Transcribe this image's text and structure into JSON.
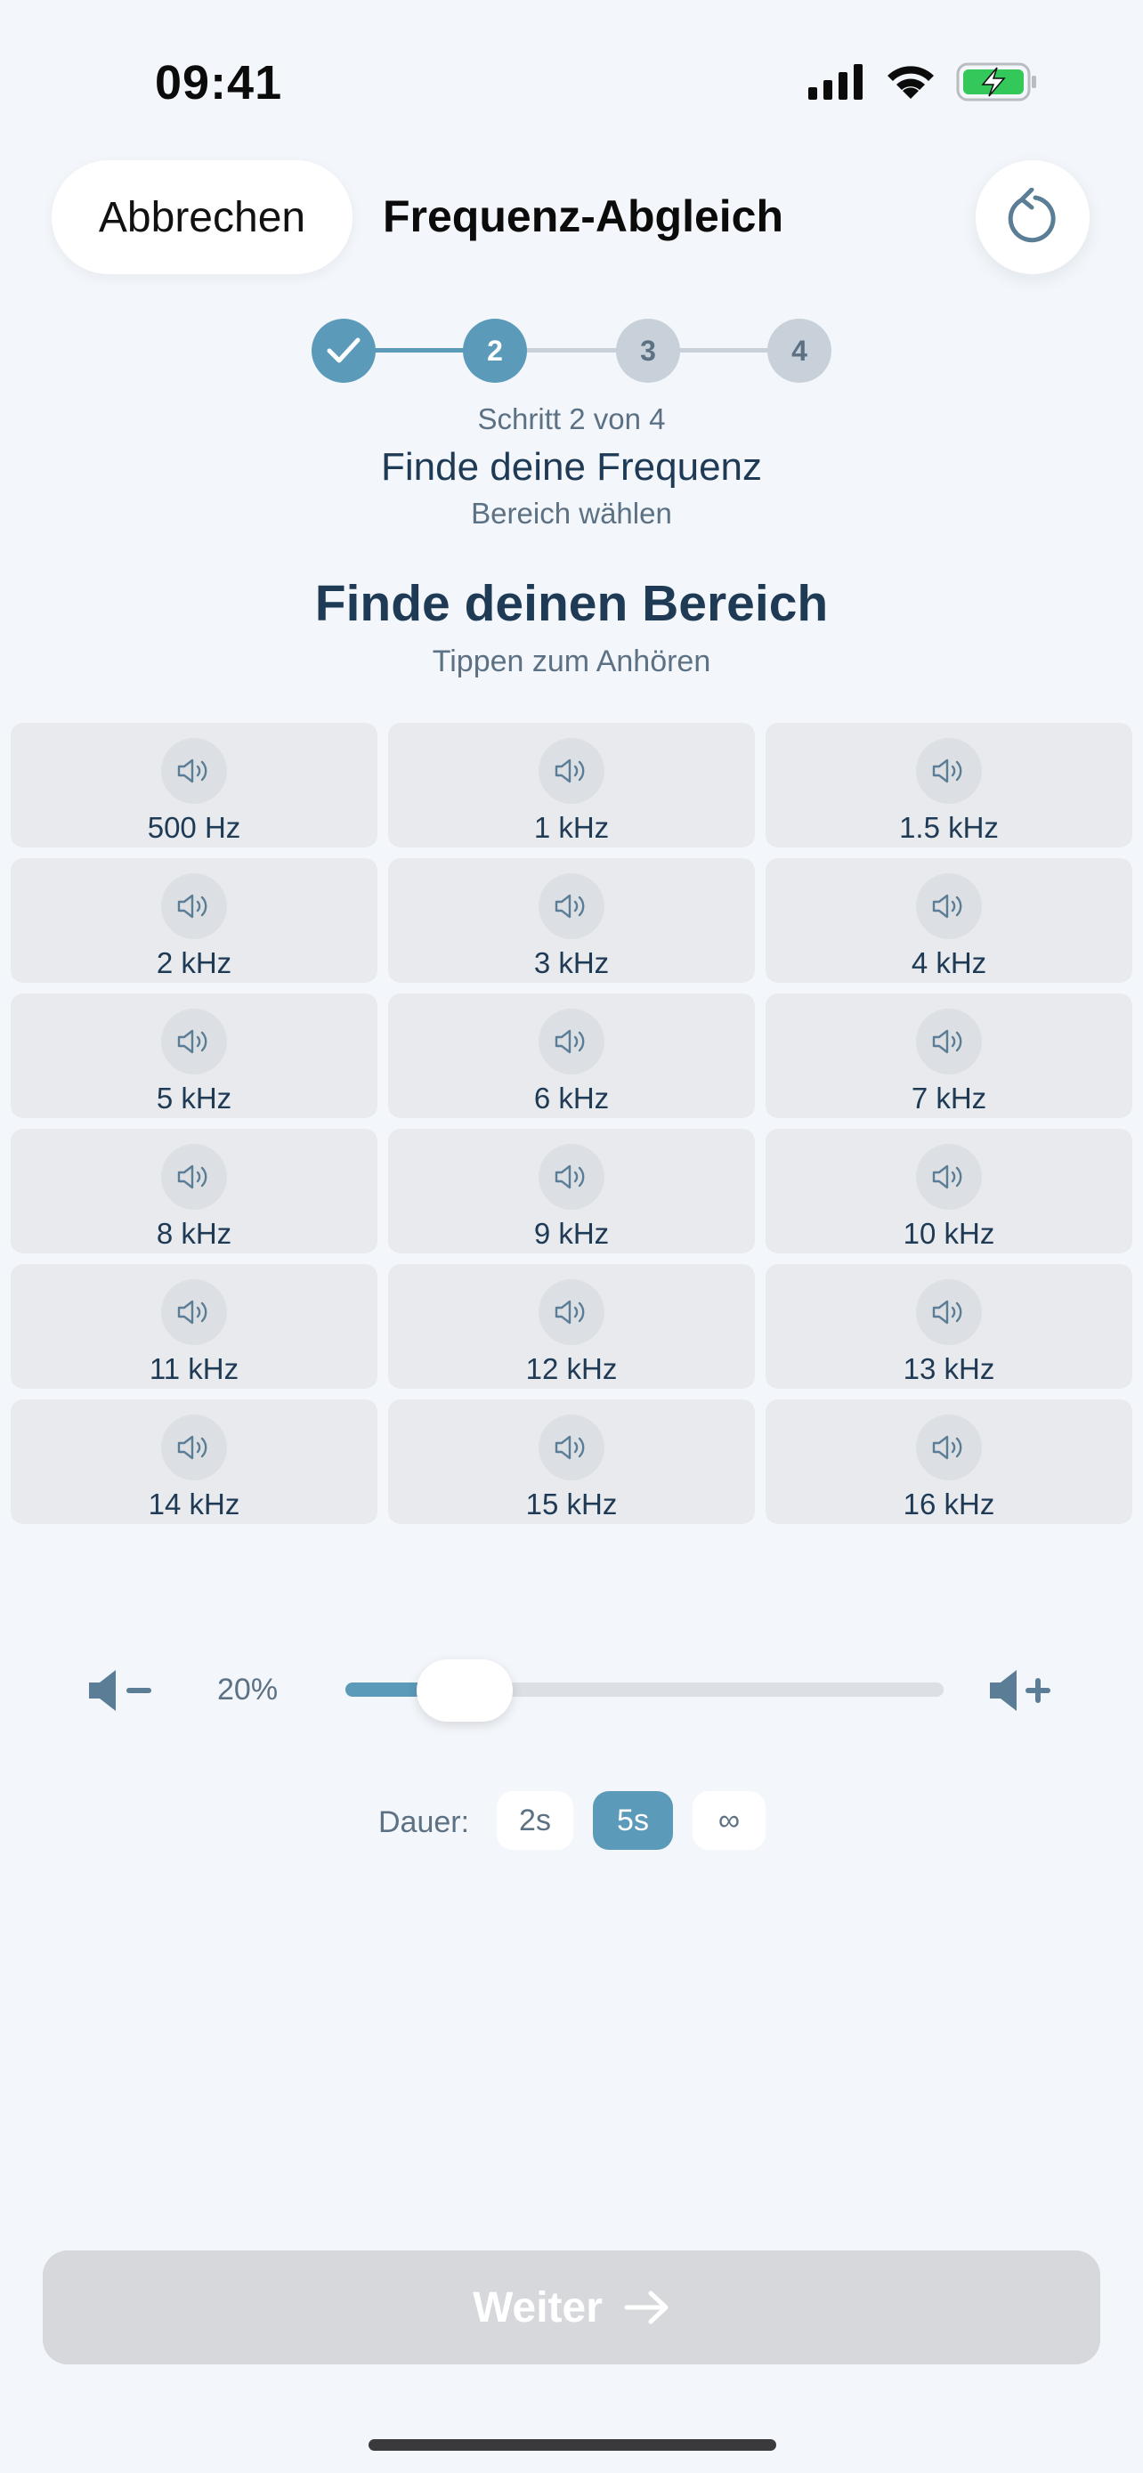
{
  "status_bar": {
    "time": "09:41"
  },
  "header": {
    "cancel_label": "Abbrechen",
    "title": "Frequenz-Abgleich"
  },
  "stepper": {
    "steps": [
      "✓",
      "2",
      "3",
      "4"
    ],
    "count_text": "Schritt 2 von 4",
    "title": "Finde deine Frequenz",
    "subtitle": "Bereich wählen"
  },
  "section": {
    "title": "Finde deinen Bereich",
    "subtitle": "Tippen zum Anhören"
  },
  "frequencies": [
    "500 Hz",
    "1 kHz",
    "1.5 kHz",
    "2 kHz",
    "3 kHz",
    "4 kHz",
    "5 kHz",
    "6 kHz",
    "7 kHz",
    "8 kHz",
    "9 kHz",
    "10 kHz",
    "11 kHz",
    "12 kHz",
    "13 kHz",
    "14 kHz",
    "15 kHz",
    "16 kHz"
  ],
  "volume": {
    "label": "20%",
    "level": 0.2
  },
  "duration": {
    "label": "Dauer:",
    "options": [
      "2s",
      "5s",
      "∞"
    ],
    "selected": "5s"
  },
  "next_button": {
    "label": "Weiter"
  },
  "colors": {
    "accent": "#5b9ab8",
    "text": "#1e3a55",
    "muted": "#5d7184",
    "background": "#f3f6fa"
  }
}
